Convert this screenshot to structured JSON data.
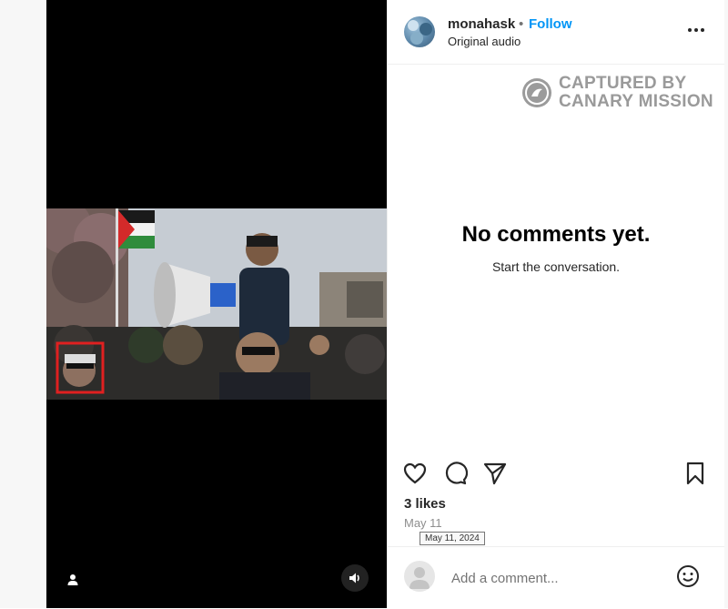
{
  "post": {
    "username": "monahask",
    "separator": "•",
    "follow_label": "Follow",
    "audio_label": "Original audio",
    "more_icon": "more-horizontal-icon"
  },
  "watermark": {
    "line1": "CAPTURED BY",
    "line2": "CANARY MISSION"
  },
  "comments": {
    "empty_title": "No comments yet.",
    "empty_subtitle": "Start the conversation."
  },
  "actions": {
    "icons": [
      "heart-icon",
      "comment-icon",
      "share-icon",
      "bookmark-icon"
    ]
  },
  "stats": {
    "likes": "3 likes",
    "date": "May 11",
    "date_tooltip": "May 11, 2024"
  },
  "composer": {
    "placeholder": "Add a comment...",
    "emoji_icon": "emoji-icon"
  },
  "media": {
    "user_tag_icon": "user-icon",
    "sound_icon": "volume-icon"
  },
  "colors": {
    "accent": "#0095f6",
    "highlight_box": "#e02020"
  }
}
